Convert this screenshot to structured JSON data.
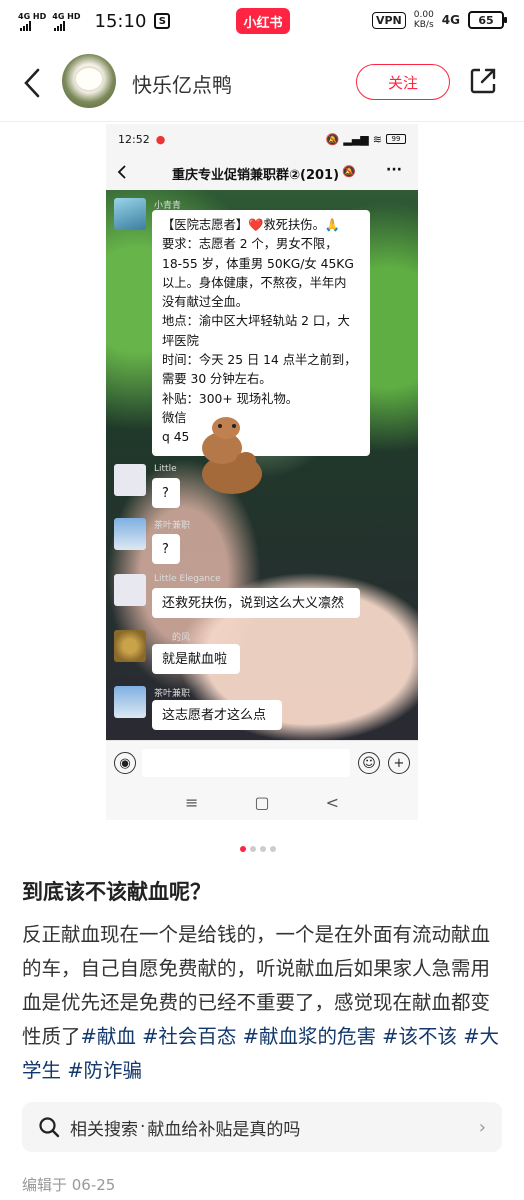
{
  "status_bar": {
    "network_a": "4G HD",
    "network_b": "4G HD",
    "time": "15:10",
    "app_icon": "S",
    "brand": "小红书",
    "vpn": "VPN",
    "speed_value": "0.00",
    "speed_unit": "KB/s",
    "network_type": "4G",
    "battery": "65"
  },
  "header": {
    "username": "快乐亿点鸭",
    "follow_label": "关注"
  },
  "screenshot": {
    "status_time": "12:52",
    "battery": "99",
    "chat_title": "重庆专业促销兼职群②(201)",
    "more": "···",
    "messages": [
      {
        "sender": "小青青",
        "lines": [
          "【医院志愿者】❤️救死扶伤。🙏",
          "要求：志愿者 2 个，男女不限，",
          "18-55 岁，体重男 50KG/女 45KG",
          "以上。身体健康，不熬夜，半年内",
          "没有献过全血。",
          "地点：渝中区大坪轻轨站 2 口，大",
          "坪医院",
          "时间：今天 25 日 14 点半之前到，",
          "需要 30 分钟左右。",
          "补贴：300+ 现场礼物。",
          "微信",
          "q        45"
        ]
      },
      {
        "sender": "Little",
        "text": "?"
      },
      {
        "sender": "茶叶兼职",
        "text": "?"
      },
      {
        "sender": "Little Elegance",
        "text": "还救死扶伤，说到这么大义凛然"
      },
      {
        "sender": "的风",
        "text": "就是献血啦"
      },
      {
        "sender": "茶叶兼职",
        "text": "这志愿者才这么点"
      }
    ],
    "nav": [
      "≡",
      "▢",
      "<"
    ]
  },
  "carousel": {
    "count": 4,
    "active": 0
  },
  "post": {
    "title": "到底该不该献血呢？",
    "body": "反正献血现在一个是给钱的，一个是在外面有流动献血的车，自己自愿免费献的，听说献血后如果家人急需用血是优先还是免费的已经不重要了，感觉现在献血都变性质了",
    "tags": [
      "#献血",
      "#社会百态",
      "#献血浆的危害",
      "#该不该",
      "#大学生",
      "#防诈骗"
    ]
  },
  "related_search": {
    "prefix": "相关搜索",
    "separator": "·",
    "query": "献血给补贴是真的吗"
  },
  "edited": "编辑于 06-25",
  "colors": {
    "brand": "#ff2442",
    "tag": "#13386c"
  }
}
